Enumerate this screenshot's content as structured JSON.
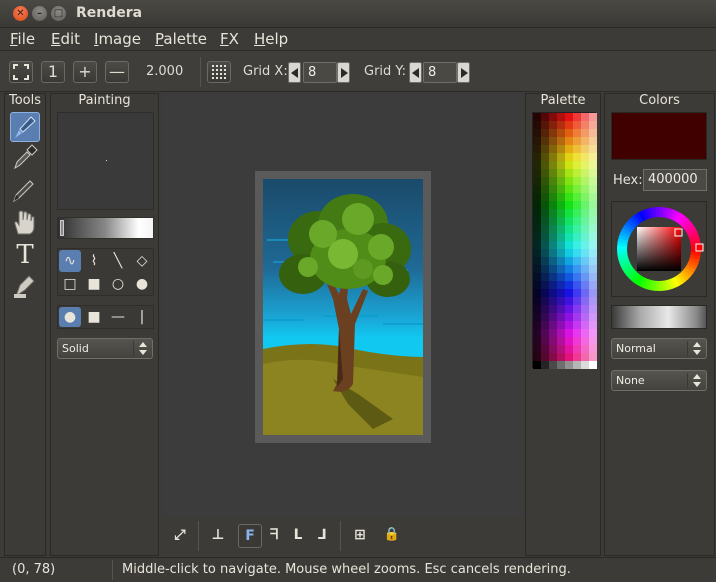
{
  "window": {
    "title": "Rendera",
    "close_glyph": "✕",
    "min_glyph": "–",
    "max_glyph": "□"
  },
  "menu": [
    {
      "u": "F",
      "rest": "ile"
    },
    {
      "u": "E",
      "rest": "dit"
    },
    {
      "u": "I",
      "rest": "mage"
    },
    {
      "u": "P",
      "rest": "alette"
    },
    {
      "u": "F",
      "rest": "X"
    },
    {
      "u": "H",
      "rest": "elp"
    }
  ],
  "toolbar": {
    "zoom_fit_icon": "fullscreen-icon",
    "zoom_one_label": "1",
    "zoom_in_label": "+",
    "zoom_out_label": "—",
    "zoom_value": "2.000",
    "grid_icon": "grid-icon",
    "grid_x_label": "Grid X:",
    "grid_x_value": "8",
    "grid_y_label": "Grid Y:",
    "grid_y_value": "8"
  },
  "panels": {
    "tools_title": "Tools",
    "painting_title": "Painting",
    "palette_title": "Palette",
    "colors_title": "Colors"
  },
  "tools": [
    "paintbrush-icon",
    "eyedropper-icon",
    "pen-icon",
    "hand-icon",
    "text-icon",
    "stamp-icon"
  ],
  "tools_text_glyph": "T",
  "painting": {
    "shape_glyphs": [
      "∿",
      "⌇",
      "╲",
      "◇",
      "□",
      "■",
      "○",
      "●"
    ],
    "style_glyphs": [
      "●",
      "■",
      "—",
      "|"
    ],
    "stroke_mode": "Solid"
  },
  "colors": {
    "current": "#400000",
    "hex_label": "Hex:",
    "hex_value": "400000",
    "blend_mode": "Normal",
    "dither_mode": "None"
  },
  "bottom_toolbar": {
    "glyphs": [
      "⤢",
      "⊥",
      "F",
      "ᖷ",
      "ᒪ",
      "⅃",
      "⊞",
      "🔒"
    ],
    "selected_index": 2
  },
  "status": {
    "coords": "(0, 78)",
    "message": "Middle-click to navigate. Mouse wheel zooms. Esc cancels rendering."
  }
}
